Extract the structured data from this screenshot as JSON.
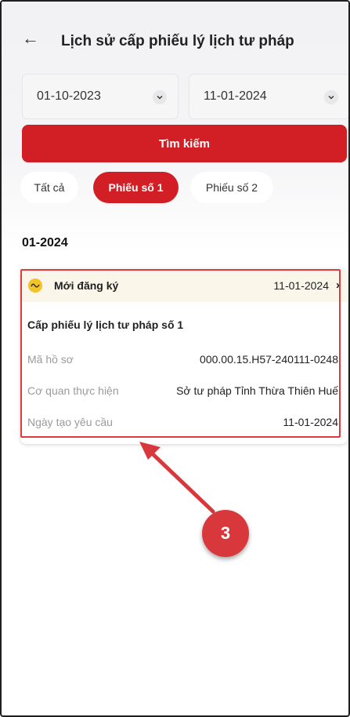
{
  "header": {
    "back_icon": "arrow-left-icon",
    "title": "Lịch sử cấp phiếu lý lịch tư pháp"
  },
  "filters": {
    "date_from": "01-10-2023",
    "date_to": "11-01-2024",
    "search_label": "Tìm kiếm"
  },
  "tabs": [
    {
      "label": "Tất cả",
      "selected": false
    },
    {
      "label": "Phiếu số 1",
      "selected": true
    },
    {
      "label": "Phiếu số 2",
      "selected": false
    }
  ],
  "group": {
    "month": "01-2024"
  },
  "record": {
    "status": "Mới đăng ký",
    "status_color": "#f3c32a",
    "date": "11-01-2024",
    "title": "Cấp phiếu lý lịch tư pháp số 1",
    "rows": [
      {
        "label": "Mã hồ sơ",
        "value": "000.00.15.H57-240111-0248"
      },
      {
        "label": "Cơ quan thực hiện",
        "value": "Sở tư pháp Tỉnh Thừa Thiên Huế"
      },
      {
        "label": "Ngày tạo yêu cầu",
        "value": "11-01-2024"
      }
    ]
  },
  "annotation": {
    "step": "3",
    "color": "#d8383c"
  },
  "colors": {
    "accent": "#d21f26"
  }
}
